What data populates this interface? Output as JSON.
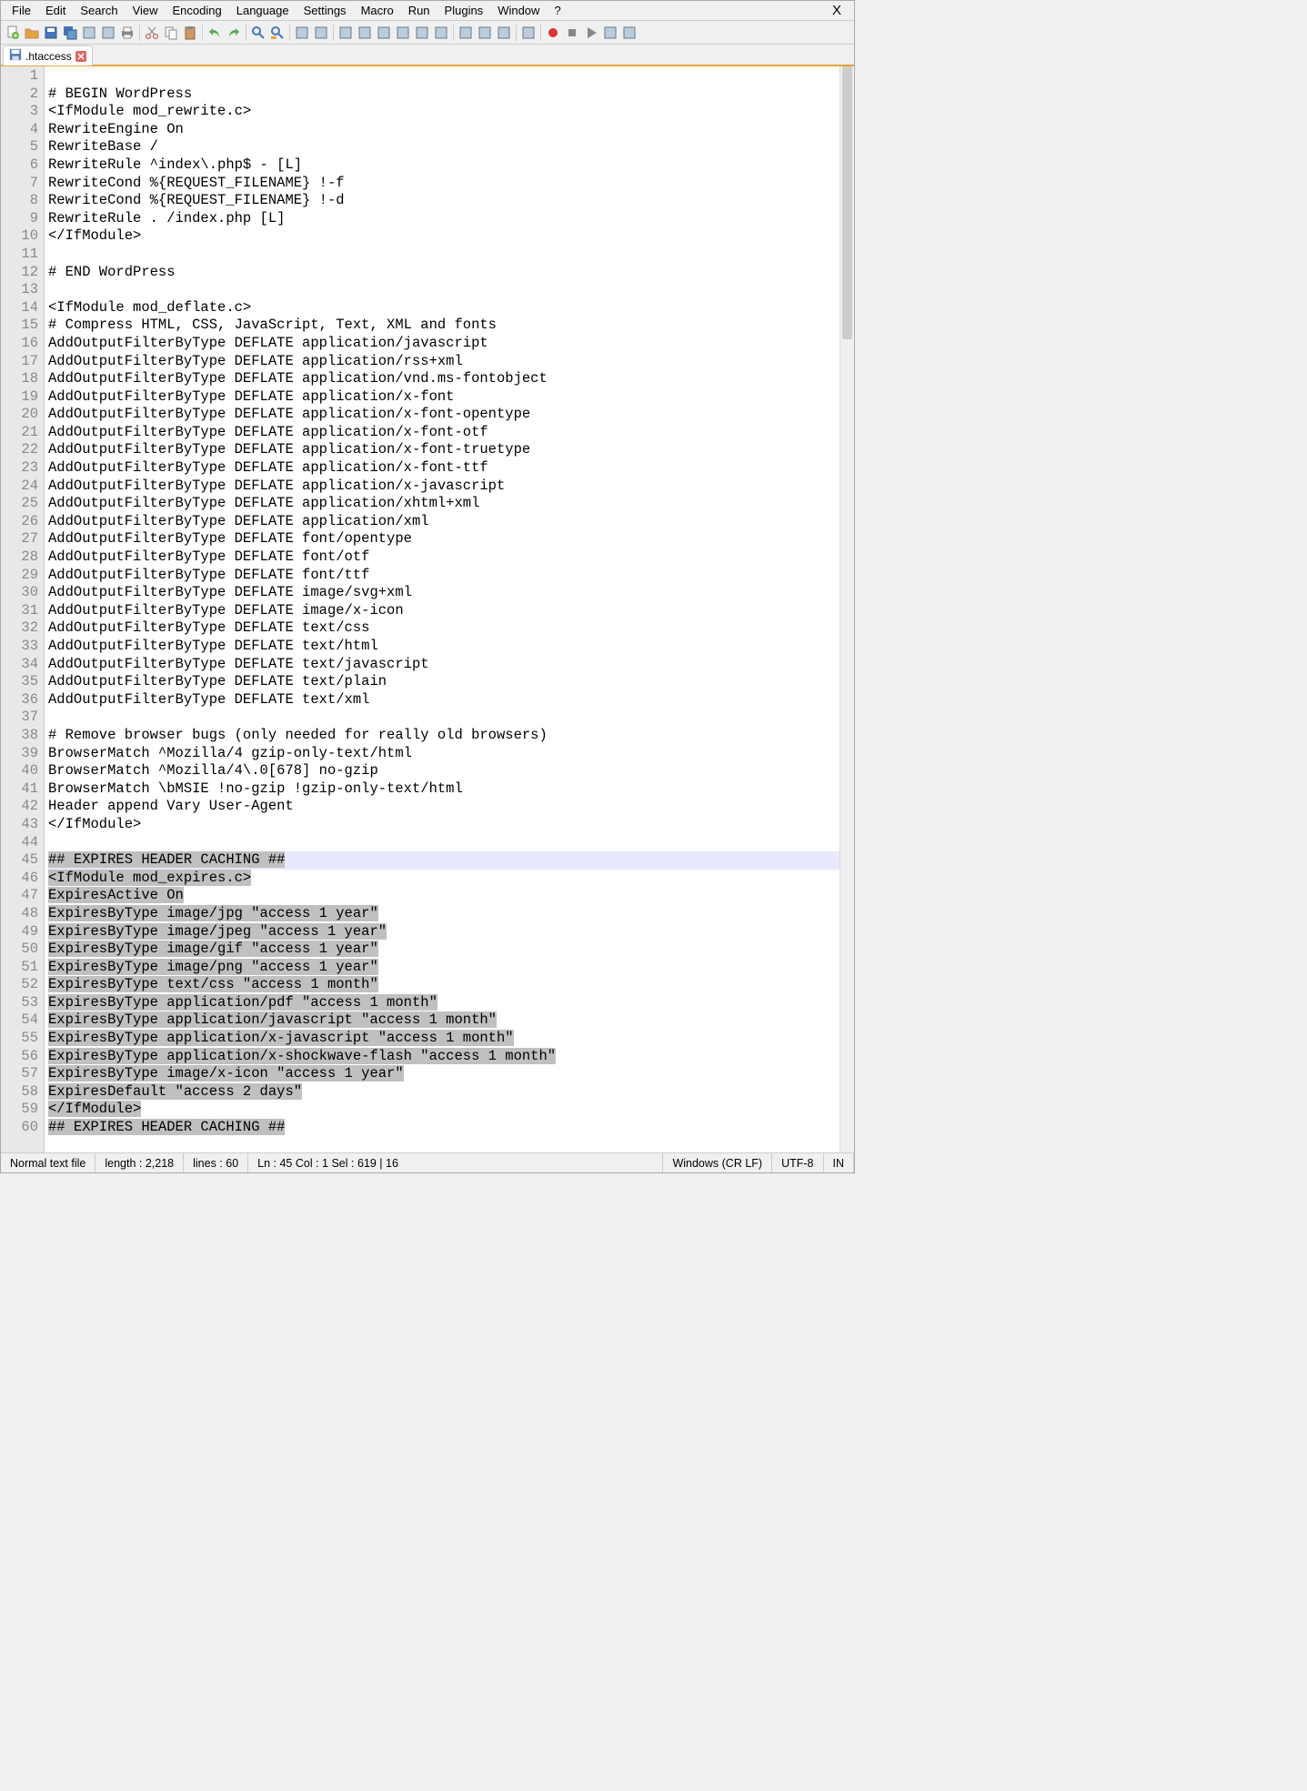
{
  "menus": [
    "File",
    "Edit",
    "Search",
    "View",
    "Encoding",
    "Language",
    "Settings",
    "Macro",
    "Run",
    "Plugins",
    "Window",
    "?"
  ],
  "close_glyph": "X",
  "tab": {
    "label": ".htaccess"
  },
  "lines": [
    "",
    "# BEGIN WordPress",
    "<IfModule mod_rewrite.c>",
    "RewriteEngine On",
    "RewriteBase /",
    "RewriteRule ^index\\.php$ - [L]",
    "RewriteCond %{REQUEST_FILENAME} !-f",
    "RewriteCond %{REQUEST_FILENAME} !-d",
    "RewriteRule . /index.php [L]",
    "</IfModule>",
    "",
    "# END WordPress",
    "",
    "<IfModule mod_deflate.c>",
    "# Compress HTML, CSS, JavaScript, Text, XML and fonts",
    "AddOutputFilterByType DEFLATE application/javascript",
    "AddOutputFilterByType DEFLATE application/rss+xml",
    "AddOutputFilterByType DEFLATE application/vnd.ms-fontobject",
    "AddOutputFilterByType DEFLATE application/x-font",
    "AddOutputFilterByType DEFLATE application/x-font-opentype",
    "AddOutputFilterByType DEFLATE application/x-font-otf",
    "AddOutputFilterByType DEFLATE application/x-font-truetype",
    "AddOutputFilterByType DEFLATE application/x-font-ttf",
    "AddOutputFilterByType DEFLATE application/x-javascript",
    "AddOutputFilterByType DEFLATE application/xhtml+xml",
    "AddOutputFilterByType DEFLATE application/xml",
    "AddOutputFilterByType DEFLATE font/opentype",
    "AddOutputFilterByType DEFLATE font/otf",
    "AddOutputFilterByType DEFLATE font/ttf",
    "AddOutputFilterByType DEFLATE image/svg+xml",
    "AddOutputFilterByType DEFLATE image/x-icon",
    "AddOutputFilterByType DEFLATE text/css",
    "AddOutputFilterByType DEFLATE text/html",
    "AddOutputFilterByType DEFLATE text/javascript",
    "AddOutputFilterByType DEFLATE text/plain",
    "AddOutputFilterByType DEFLATE text/xml",
    "",
    "# Remove browser bugs (only needed for really old browsers)",
    "BrowserMatch ^Mozilla/4 gzip-only-text/html",
    "BrowserMatch ^Mozilla/4\\.0[678] no-gzip",
    "BrowserMatch \\bMSIE !no-gzip !gzip-only-text/html",
    "Header append Vary User-Agent",
    "</IfModule>",
    "",
    "## EXPIRES HEADER CACHING ##",
    "<IfModule mod_expires.c>",
    "ExpiresActive On",
    "ExpiresByType image/jpg \"access 1 year\"",
    "ExpiresByType image/jpeg \"access 1 year\"",
    "ExpiresByType image/gif \"access 1 year\"",
    "ExpiresByType image/png \"access 1 year\"",
    "ExpiresByType text/css \"access 1 month\"",
    "ExpiresByType application/pdf \"access 1 month\"",
    "ExpiresByType application/javascript \"access 1 month\"",
    "ExpiresByType application/x-javascript \"access 1 month\"",
    "ExpiresByType application/x-shockwave-flash \"access 1 month\"",
    "ExpiresByType image/x-icon \"access 1 year\"",
    "ExpiresDefault \"access 2 days\"",
    "</IfModule>",
    "## EXPIRES HEADER CACHING ##"
  ],
  "highlight_line": 45,
  "selection_start": 45,
  "selection_end": 60,
  "status": {
    "type": "Normal text file",
    "length": "length : 2,218",
    "lines": "lines : 60",
    "pos": "Ln : 45    Col : 1    Sel : 619 | 16",
    "eol": "Windows (CR LF)",
    "enc": "UTF-8",
    "ins": "IN"
  },
  "toolbar_icons": [
    "new-file-icon",
    "open-file-icon",
    "save-icon",
    "save-all-icon",
    "close-icon",
    "close-all-icon",
    "print-icon",
    "sep",
    "cut-icon",
    "copy-icon",
    "paste-icon",
    "sep",
    "undo-icon",
    "redo-icon",
    "sep",
    "find-icon",
    "replace-icon",
    "sep",
    "zoom-in-icon",
    "zoom-out-icon",
    "sep",
    "sync-v-icon",
    "sync-h-icon",
    "wrap-icon",
    "show-all-icon",
    "indent-icon",
    "outdent-icon",
    "sep",
    "folder-icon",
    "doc-map-icon",
    "function-list-icon",
    "sep",
    "monitor-icon",
    "sep",
    "record-icon",
    "stop-icon",
    "play-icon",
    "play-multi-icon",
    "save-macro-icon"
  ]
}
